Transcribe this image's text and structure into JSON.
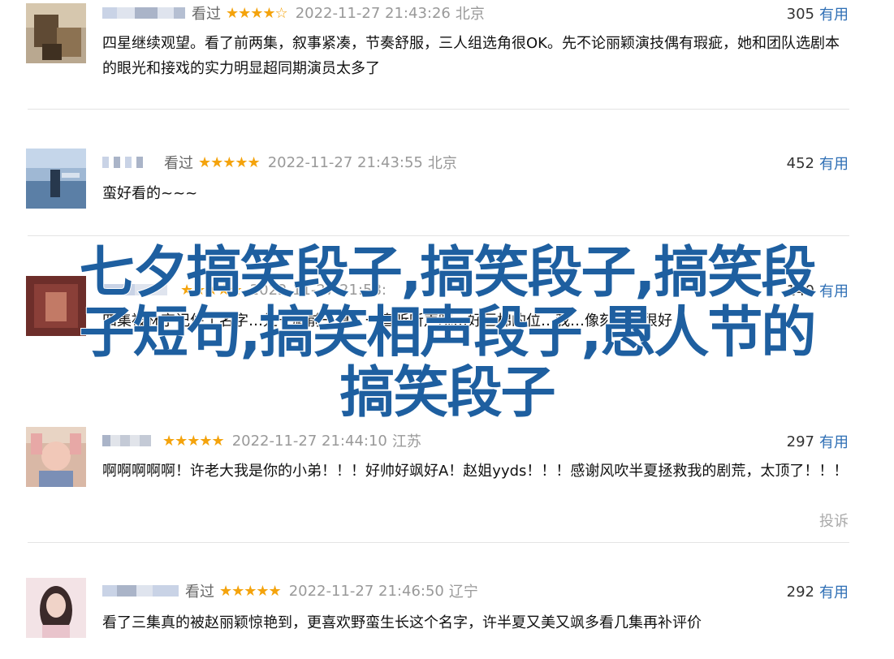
{
  "colors": {
    "stars": "#f4a30c",
    "useful_link": "#2f6fb5",
    "overlay_text": "#1e5fa0"
  },
  "reviews": [
    {
      "watched": "看过",
      "stars": "★★★★☆",
      "time": "2022-11-27 21:43:26",
      "location": "北京",
      "useful_count": "305",
      "useful_label": "有用",
      "text": "四星继续观望。看了前两集，叙事紧凑，节奏舒服，三人组选角很OK。先不论丽颖演技偶有瑕疵，她和团队选剧本的眼光和接戏的实力明显超同期演员太多了"
    },
    {
      "watched": "看过",
      "stars": "★★★★★",
      "time": "2022-11-27 21:43:55",
      "location": "北京",
      "useful_count": "452",
      "useful_label": "有用",
      "text": "蛮好看的~~~"
    },
    {
      "stars": "★★★★★",
      "time": "2022-11-27 21:58:",
      "location": "",
      "useful_count": "140",
      "useful_label": "有用",
      "text": "四集被林宇记住了名字…处于胸前一夏，一直听听声晓…好巨棉的位…我…像刻画的很好"
    },
    {
      "stars": "★★★★★",
      "time": "2022-11-27 21:44:10",
      "location": "江苏",
      "useful_count": "297",
      "useful_label": "有用",
      "text": "啊啊啊啊啊！许老大我是你的小弟！！！好帅好飒好A！赵姐yyds！！！感谢风吹半夏拯救我的剧荒，太顶了！！！",
      "report": "投诉"
    },
    {
      "watched": "看过",
      "stars": "★★★★★",
      "time": "2022-11-27 21:46:50",
      "location": "辽宁",
      "useful_count": "292",
      "useful_label": "有用",
      "text": "看了三集真的被赵丽颖惊艳到，更喜欢野蛮生长这个名字，许半夏又美又飒多看几集再补评价"
    }
  ],
  "overlay": {
    "line1": "七夕搞笑段子,搞笑段子,搞笑段",
    "line2": "子短句,搞笑相声段子,愚人节的",
    "line3": "搞笑段子"
  }
}
